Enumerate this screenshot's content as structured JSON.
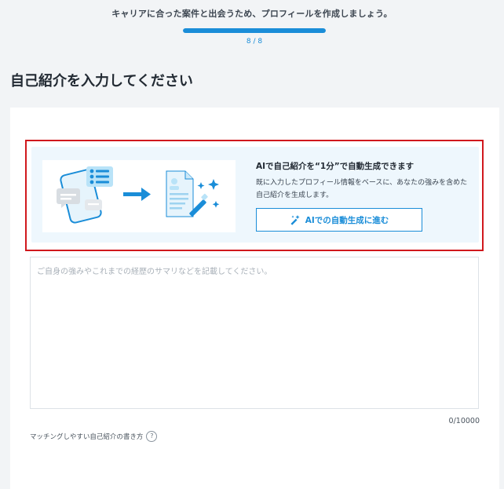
{
  "header": {
    "subtitle": "キャリアに合った案件と出会うため、プロフィールを作成しましょう。",
    "step_label": "8 / 8",
    "progress": 1.0
  },
  "page": {
    "title": "自己紹介を入力してください"
  },
  "ai_panel": {
    "title": "AIで自己紹介を“1分”で自動生成できます",
    "description": "既に入力したプロフィール情報をベースに、あなたの強みを含めた自己紹介を生成します。",
    "button_label": "AIでの自動生成に進む",
    "button_icon": "magic-wand-icon"
  },
  "intro_field": {
    "value": "",
    "placeholder": "ご自身の強みやこれまでの経歴のサマリなどを記載してください。",
    "counter": "0/10000"
  },
  "help": {
    "label": "マッチングしやすい自己紹介の書き方",
    "icon": "question-circle-icon"
  },
  "colors": {
    "accent": "#1a8dd8",
    "highlight_border": "#d0181d",
    "panel_bg": "#eef7fd"
  }
}
